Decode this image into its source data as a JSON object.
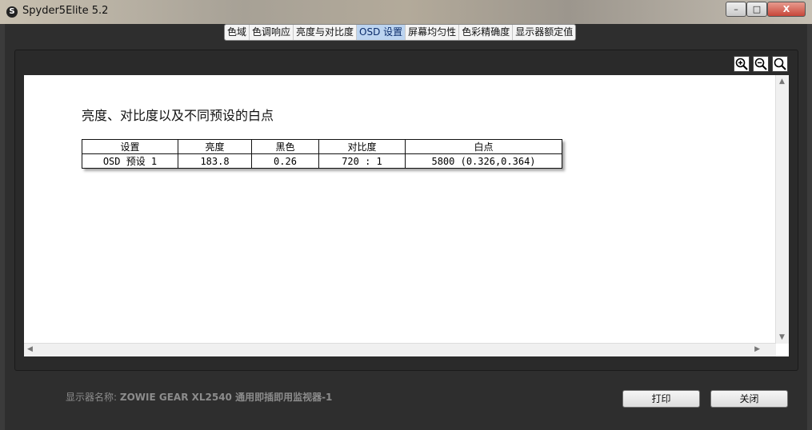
{
  "window": {
    "title": "Spyder5Elite 5.2",
    "minimize_label": "–",
    "restore_label": "□",
    "close_label": "X"
  },
  "tabs": [
    {
      "label": "色域"
    },
    {
      "label": "色调响应"
    },
    {
      "label": "亮度与对比度"
    },
    {
      "label": "OSD 设置",
      "active": true
    },
    {
      "label": "屏幕均匀性"
    },
    {
      "label": "色彩精确度"
    },
    {
      "label": "显示器额定值"
    }
  ],
  "zoom_tools": [
    "zoom-in-icon",
    "zoom-out-icon",
    "zoom-fit-icon"
  ],
  "report": {
    "title": "亮度、对比度以及不同预设的白点",
    "table": {
      "headers": [
        "设置",
        "亮度",
        "黑色",
        "对比度",
        "白点"
      ],
      "rows": [
        [
          "OSD 预设 1",
          "183.8",
          "0.26",
          "720 : 1",
          "5800 (0.326,0.364)"
        ]
      ]
    }
  },
  "footer": {
    "display_name_label": "显示器名称:",
    "display_name_value": "ZOWIE GEAR XL2540 通用即插即用监视器-1",
    "print_label": "打印",
    "close_label": "关闭"
  },
  "colors": {
    "background": "#2e2e2e",
    "active_tab": "#bcd4f0"
  }
}
